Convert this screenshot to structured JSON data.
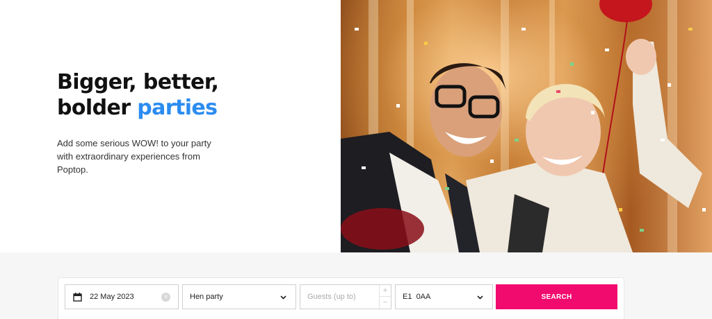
{
  "hero": {
    "title_line1": "Bigger, better,",
    "title_line2_prefix": "bolder ",
    "title_line2_accent": "parties",
    "subtitle": "Add some serious WOW! to your party with extraordinary experiences from Poptop.",
    "accent_color": "#2b8cf0"
  },
  "search": {
    "date_value": "22 May 2023",
    "date_icon": "calendar-icon",
    "clear_icon": "clear-icon",
    "event_type_value": "Hen party",
    "guests_placeholder": "Guests (up to)",
    "guests_plus": "+",
    "guests_minus": "−",
    "postcode_value": "E1  0AA",
    "button_label": "SEARCH",
    "button_color": "#f20b6e"
  }
}
